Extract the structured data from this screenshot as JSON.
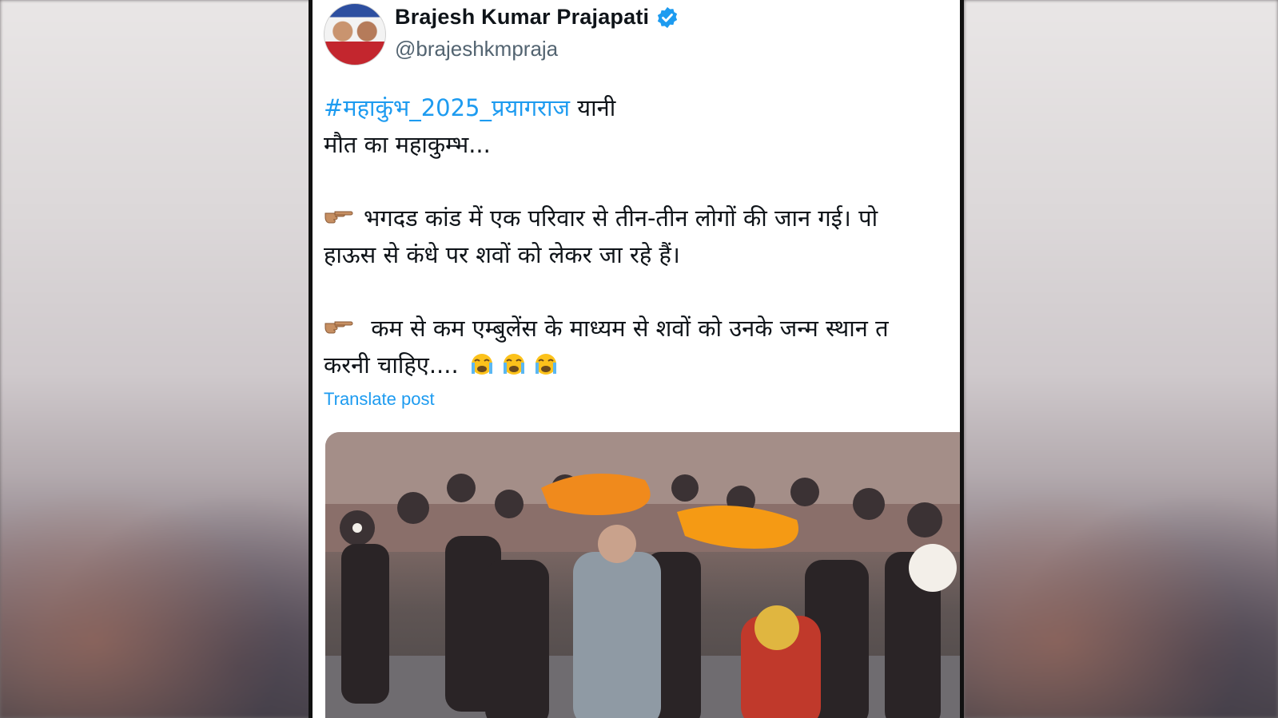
{
  "post": {
    "author": {
      "display_name": "Brajesh Kumar Prajapati",
      "handle": "@brajeshkmpraja",
      "verified": true,
      "verified_icon": "verified-badge-icon",
      "avatar_icon": "avatar"
    },
    "text": {
      "hashtag": "#महाकुंभ_2025_प्रयागराज",
      "line1_rest": " यानी",
      "line2": "मौत का महाकुम्भ...",
      "line3": "भगदड कांड में एक परिवार से तीन-तीन लोगों की जान गई। पो",
      "line4": "हाऊस से कंधे पर शवों को लेकर जा रहे हैं।",
      "line5": " कम से कम एम्बुलेंस के माध्यम से शवों को उनके जन्म स्थान त",
      "line6": "करनी चाहिए....",
      "bullet_icon": "pointing-hand-icon",
      "crying_emoji_icon": "loudly-crying-face-icon"
    },
    "translate_label": "Translate post"
  },
  "colors": {
    "link": "#1d9bf0",
    "text": "#0f1419",
    "muted": "#536471"
  }
}
